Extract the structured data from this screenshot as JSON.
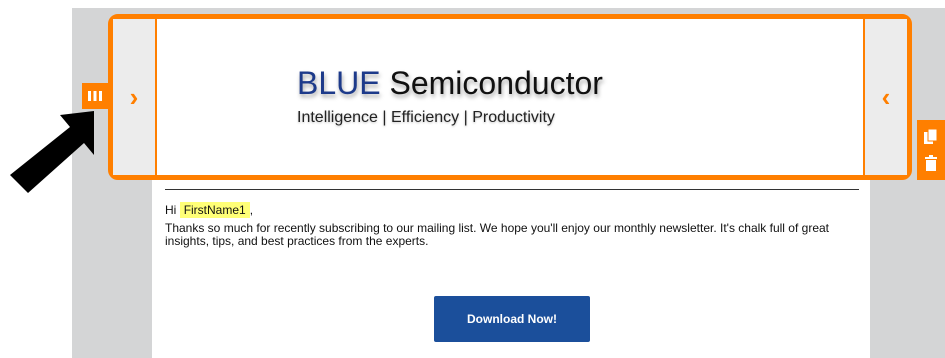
{
  "header": {
    "brand_highlight": "BLUE",
    "brand_rest": "Semiconductor",
    "tagline": "Intelligence | Efficiency | Productivity"
  },
  "controls": {
    "left_nav_icon": "chevron-right-icon",
    "right_nav_icon": "chevron-left-icon",
    "drag_handle_icon": "grip-columns-icon",
    "copy_icon": "copy-icon",
    "delete_icon": "trash-icon",
    "pointer_icon": "arrow-pointer-icon"
  },
  "content": {
    "greeting_prefix": "Hi",
    "merge_tag": "FirstName1",
    "greeting_suffix": ",",
    "paragraph": "Thanks so much for recently subscribing to our mailing list. We hope you'll enjoy our monthly newsletter. It's chalk full of great insights, tips, and best practices from the experts.",
    "cta_label": "Download Now!"
  },
  "colors": {
    "accent": "#ff7f00",
    "brand_blue": "#1d3a8a",
    "button_blue": "#1b4f9b",
    "merge_highlight": "#ffff77",
    "canvas_gray": "#d4d5d6"
  }
}
